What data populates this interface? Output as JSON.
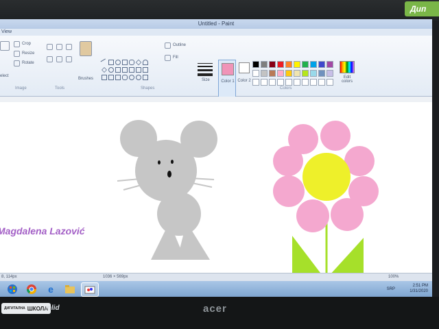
{
  "monitor": {
    "brand_badge": "Дип",
    "logo": "acer",
    "sticker_label": "ШКОЛА",
    "sticker_small": "ДИГИТАЛНА",
    "sticker_brand": "mlid"
  },
  "window": {
    "title": "Untitled - Paint"
  },
  "ribbon": {
    "tab_view": "View",
    "tools": {
      "crop": "Crop",
      "resize": "Resize",
      "rotate": "Rotate",
      "select": "elect",
      "image_group": "Image",
      "tools_group": "Tools"
    },
    "brushes": "Brushes",
    "shapes": {
      "outline": "Outline",
      "fill": "Fill",
      "group": "Shapes"
    },
    "size": "Size",
    "color1": {
      "label": "Color 1",
      "value": "#f094b8"
    },
    "color2": {
      "label": "Color 2",
      "value": "#ffffff"
    },
    "edit_colors": "Edit colors",
    "colors_group": "Colors",
    "palette_row1": [
      "#000000",
      "#7f7f7f",
      "#880015",
      "#ed1c24",
      "#ff7f27",
      "#fff200",
      "#22b14c",
      "#00a2e8",
      "#3f48cc",
      "#a349a4"
    ],
    "palette_row2": [
      "#ffffff",
      "#c3c3c3",
      "#b97a57",
      "#ffaec9",
      "#ffc90e",
      "#efe4b0",
      "#b5e61d",
      "#99d9ea",
      "#7092be",
      "#c8bfe7"
    ]
  },
  "canvas": {
    "author": "Magdalena Lazović",
    "mouse_color": "#c6c6c6",
    "flower_petal_color": "#f4a8cf",
    "flower_center_color": "#eef02a",
    "leaf_color": "#a6e02a"
  },
  "status": {
    "cursor_pos": "8, 114px",
    "canvas_size": "1036 × 569px",
    "zoom": "100%"
  },
  "tray": {
    "time": "2:51 PM",
    "date": "1/31/2020",
    "lang": "SRP"
  }
}
